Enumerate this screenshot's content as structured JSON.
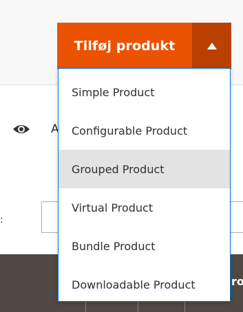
{
  "header": {
    "add_product_label": "Tilføj produkt",
    "toggle_icon": "caret-up-icon",
    "primary_color": "#eb5202",
    "toggle_color": "#ba4000"
  },
  "toolbar": {
    "view_icon": "eye-icon",
    "clipped_label": "A",
    "left_clipped_char": ":"
  },
  "grid": {
    "clipped_column_label": "ro"
  },
  "dropdown": {
    "items": [
      {
        "label": "Simple Product"
      },
      {
        "label": "Configurable Product"
      },
      {
        "label": "Grouped Product",
        "highlighted": true
      },
      {
        "label": "Virtual Product"
      },
      {
        "label": "Bundle Product"
      },
      {
        "label": "Downloadable Product"
      }
    ],
    "border_color": "#007bdb",
    "highlight_color": "#e3e3e3"
  }
}
